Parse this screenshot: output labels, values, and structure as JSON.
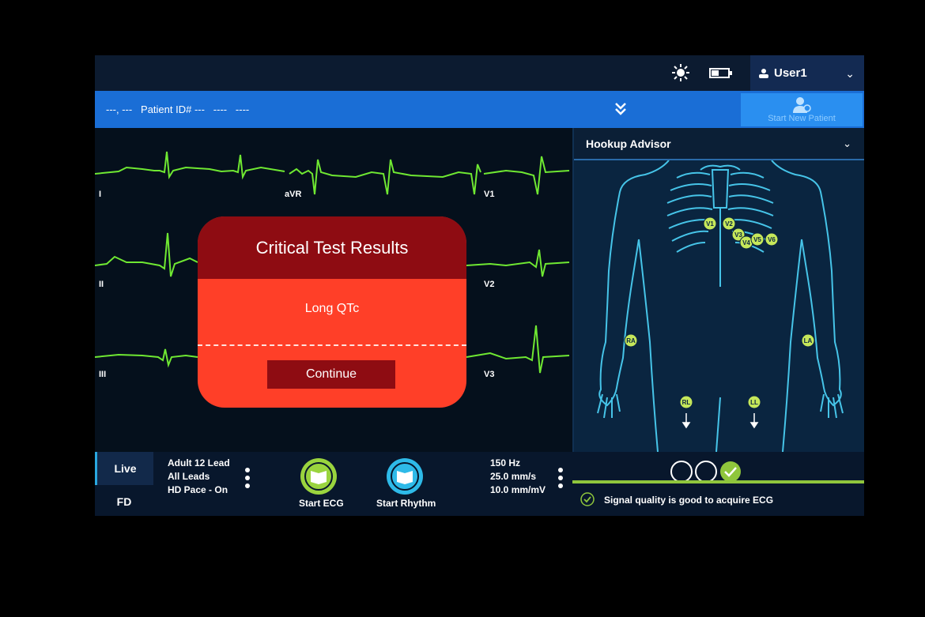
{
  "topbar": {
    "icons": [
      "brightness-icon",
      "battery-icon",
      "user-icon"
    ],
    "user_name": "User1",
    "user_menu_chevron": "⌄"
  },
  "patient_bar": {
    "info": "---, ---   Patient ID# ---   ----   ----",
    "expand_icon": "double-chevron-down-icon",
    "start_new_patient_label": "Start New Patient"
  },
  "waveforms": {
    "leads": [
      "I",
      "aVR",
      "V1",
      "II",
      "V2",
      "III",
      "V3"
    ],
    "trace_color": "#6fe832"
  },
  "hookup_advisor": {
    "title": "Hookup Advisor",
    "electrodes": [
      "V1",
      "V2",
      "V3",
      "V4",
      "V5",
      "V6",
      "RA",
      "LA",
      "RL",
      "LL"
    ],
    "electrode_color": "#c6e85a"
  },
  "modal": {
    "title": "Critical Test Results",
    "message": "Long QTc",
    "continue_label": "Continue",
    "header_color": "#8e0c12",
    "body_color": "#ff3f28"
  },
  "bottom_bar": {
    "mode_live": "Live",
    "mode_fd": "FD",
    "protocol": [
      "Adult 12 Lead",
      "All Leads",
      "HD Pace - On"
    ],
    "start_ecg_label": "Start ECG",
    "start_rhythm_label": "Start Rhythm",
    "filters": [
      "150 Hz",
      "25.0 mm/s",
      "10.0 mm/mV"
    ],
    "signal_message": "Signal quality is good to acquire ECG",
    "signal_color": "#8fc63c"
  }
}
